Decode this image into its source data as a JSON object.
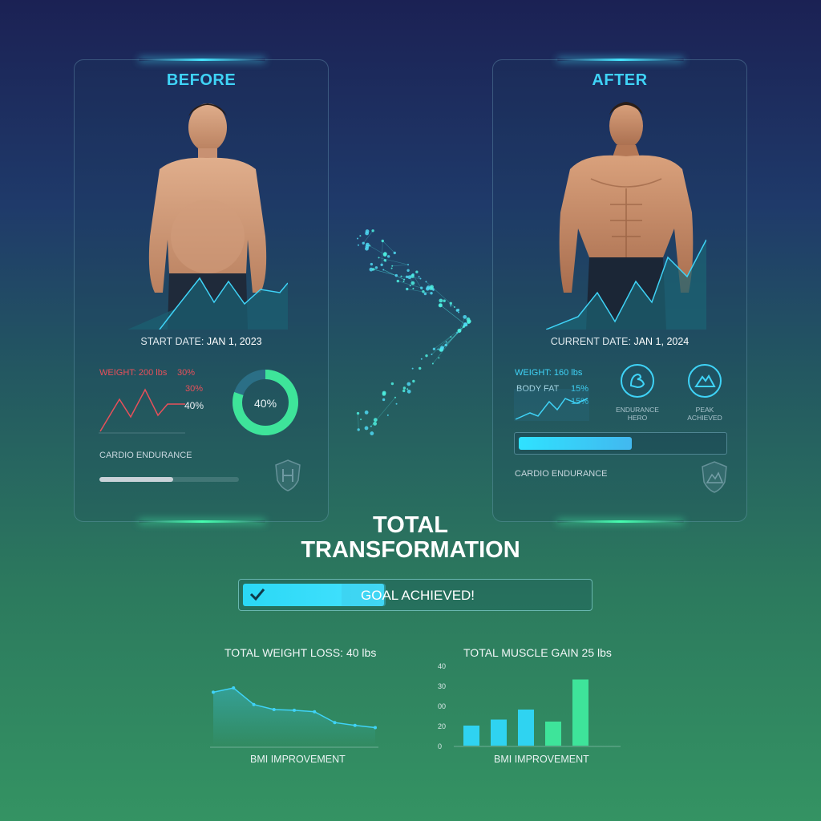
{
  "before": {
    "title": "BEFORE",
    "date_label": "START DATE:",
    "date_value": "JAN 1, 2023",
    "weight": "WEIGHT: 200 lbs",
    "pct_a": "30%",
    "pct_b": "30%",
    "pct_c": "40%",
    "ring_value": "40%",
    "ring_fraction": 0.8,
    "endurance_label": "CARDIO ENDURANCE",
    "endurance_fraction": 0.53,
    "badge_icon": "shield-icon"
  },
  "after": {
    "title": "AFTER",
    "date_label": "CURRENT DATE:",
    "date_value": "JAN 1, 2024",
    "weight": "WEIGHT: 160 lbs",
    "body_fat": "BODY FAT",
    "bf_a": "15%",
    "bf_b": "15%",
    "badge1": "ENDURANCE HERO",
    "badge1_icon": "flexed-arm-icon",
    "badge2": "PEAK ACHIEVED",
    "badge2_icon": "mountain-icon",
    "progress_fraction": 0.55,
    "endurance_label": "CARDIO ENDURANCE",
    "badge3_icon": "mountain-shield-icon"
  },
  "summary": {
    "heading_line1": "TOTAL",
    "heading_line2": "TRANSFORMATION",
    "goal_label": "GOAL ACHIEVED!",
    "goal_icon": "checkmark-icon"
  },
  "chart_data": [
    {
      "type": "area",
      "title": "TOTAL WEIGHT LOSS: 40 lbs",
      "xlabel": "BMI IMPROVEMENT",
      "ylabel": "",
      "values": [
        0.74,
        0.8,
        0.57,
        0.5,
        0.49,
        0.47,
        0.32,
        0.28,
        0.25
      ],
      "ylim": [
        0,
        1
      ]
    },
    {
      "type": "bar",
      "title": "TOTAL MUSCLE GAIN 25 lbs",
      "xlabel": "BMI IMPROVEMENT",
      "ylabel": "",
      "yticks": [
        "0",
        "20",
        "00",
        "30",
        "40"
      ],
      "values": [
        10,
        13,
        18,
        12,
        33
      ],
      "ylim": [
        0,
        40
      ],
      "colors": [
        "#2fd3f1",
        "#2fd3f1",
        "#2fd3f1",
        "#3ee49a",
        "#3ee49a"
      ]
    }
  ],
  "colors": {
    "accent_cyan": "#3fd3f7",
    "accent_green": "#3ee49a",
    "warning_red": "#e8505a"
  }
}
